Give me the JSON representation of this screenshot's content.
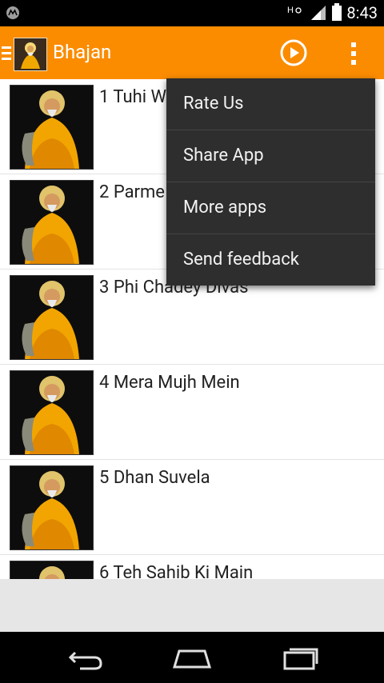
{
  "status_bar": {
    "time": "8:43"
  },
  "app_bar": {
    "title": "Bhajan",
    "accent": "#fb8c00"
  },
  "list": {
    "items": [
      {
        "label": "1 Tuhi W"
      },
      {
        "label": "2 Parme"
      },
      {
        "label": "3 Phi Chadey Divas"
      },
      {
        "label": "4 Mera Mujh Mein"
      },
      {
        "label": "5 Dhan Suvela"
      },
      {
        "label": "6 Teh Sahib Ki Main"
      }
    ]
  },
  "menu": {
    "items": [
      {
        "label": "Rate Us"
      },
      {
        "label": "Share App"
      },
      {
        "label": "More apps"
      },
      {
        "label": "Send feedback"
      }
    ]
  },
  "icons": {
    "drawer": "menu-icon",
    "play": "play-circle-icon",
    "overflow": "more-vert-icon",
    "back": "back-icon",
    "home": "home-icon",
    "recent": "recent-apps-icon"
  }
}
